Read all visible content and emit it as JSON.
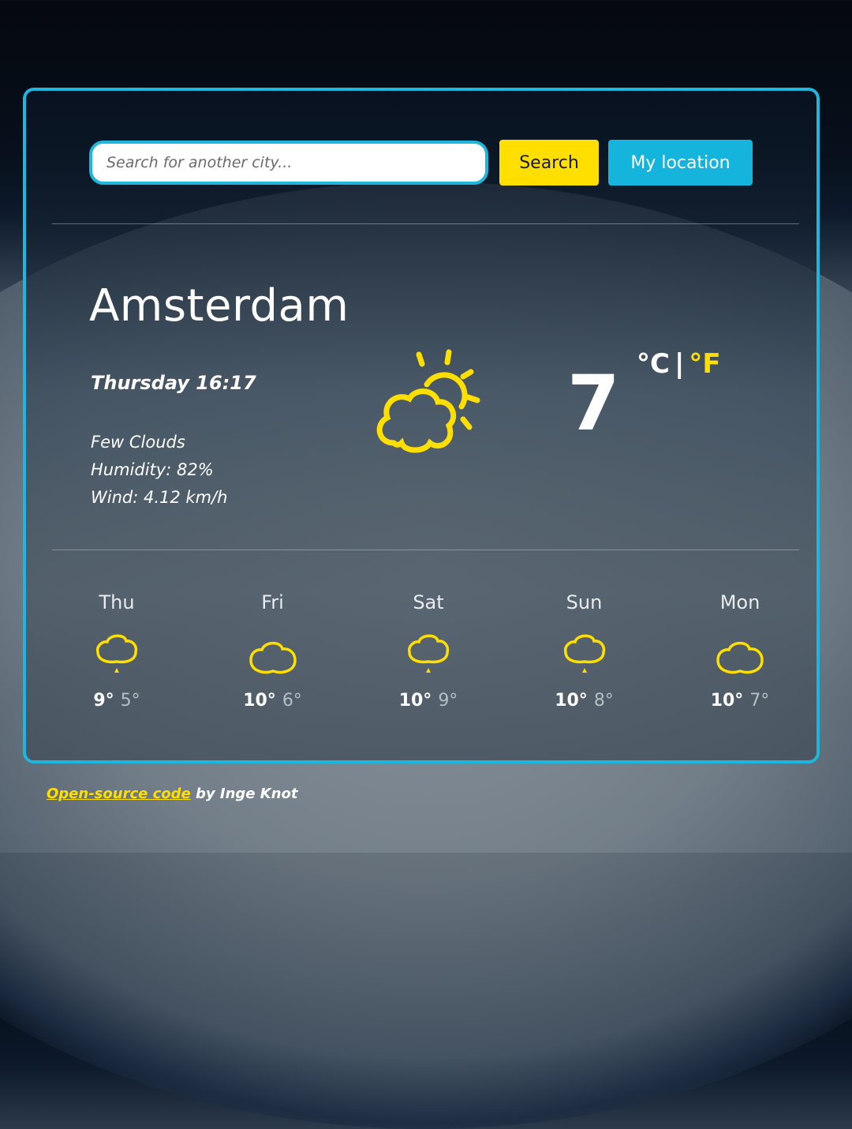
{
  "search": {
    "placeholder": "Search for another city...",
    "value": "",
    "search_label": "Search",
    "location_label": "My location"
  },
  "current": {
    "city": "Amsterdam",
    "datetime": "Thursday 16:17",
    "description": "Few Clouds",
    "humidity": "Humidity: 82%",
    "wind": "Wind: 4.12 km/h",
    "temperature": "7",
    "unit_c": "°C",
    "unit_separator": "|",
    "unit_f": "°F",
    "icon": "partly-cloudy-icon"
  },
  "forecast": [
    {
      "day": "Thu",
      "high": "9°",
      "low": "5°",
      "icon": "rain-cloud-icon"
    },
    {
      "day": "Fri",
      "high": "10°",
      "low": "6°",
      "icon": "cloud-icon"
    },
    {
      "day": "Sat",
      "high": "10°",
      "low": "9°",
      "icon": "rain-cloud-icon"
    },
    {
      "day": "Sun",
      "high": "10°",
      "low": "8°",
      "icon": "rain-cloud-icon"
    },
    {
      "day": "Mon",
      "high": "10°",
      "low": "7°",
      "icon": "cloud-icon"
    }
  ],
  "footer": {
    "link_text": "Open-source code",
    "suffix": " by Inge Knot"
  },
  "colors": {
    "accent_blue": "#1eb6dc",
    "accent_yellow": "#ffdf00"
  }
}
